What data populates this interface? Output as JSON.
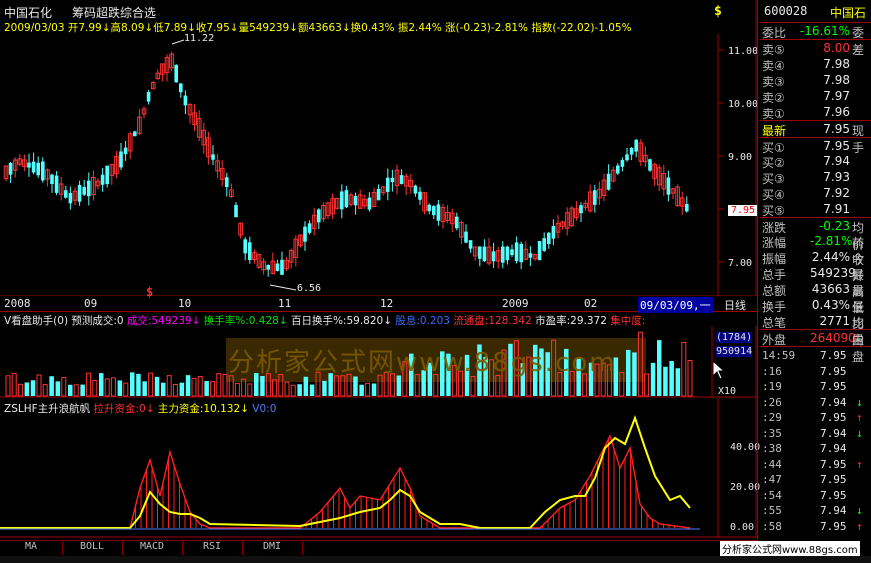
{
  "header": {
    "stock_name": "中国石化",
    "tab": "筹码超跌综合选",
    "badge": "$",
    "line": "2009/03/03 开7.99↓高8.09↓低7.89↓收7.95↓量549239↓额43663↓换0.43% 振2.44% 涨(-0.23)-2.81% 指数(-22.02)-1.05%"
  },
  "main": {
    "price_ticks": [
      "11.00",
      "10.00",
      "9.00",
      "8.00",
      "7.00"
    ],
    "high_label": "11.22",
    "low_label": "6.56",
    "current_price": "7.95",
    "dollar_marker": "$",
    "date_axis": [
      "2008",
      "09",
      "10",
      "11",
      "12",
      "2009",
      "02",
      "09/03/09,一"
    ],
    "date_axis_right": "日线"
  },
  "volume_panel": {
    "title": "V看盘助手(0) 预测成交:0",
    "fields": [
      {
        "text": "成交:549239↓",
        "color": "#ff00ff"
      },
      {
        "text": "换手率%:0.428↓",
        "color": "#00e000"
      },
      {
        "text": "百日换手%:59.820↓",
        "color": "#e8e8e8"
      },
      {
        "text": "股息:0.203",
        "color": "#3b6bff"
      },
      {
        "text": "流通盘:128.342",
        "color": "#ff3232"
      },
      {
        "text": "市盈率:29.372",
        "color": "#e8e8e8"
      },
      {
        "text": "集中度:",
        "color": "#ff3232"
      }
    ],
    "scale_top": "(1784)",
    "scale_value": "950914",
    "scale_unit": "X10",
    "watermark": "分析家公式网www.88gs.com"
  },
  "indicator_panel": {
    "title": "ZSLHF主升浪航帆",
    "fields": [
      {
        "text": "拉升资金:0↓",
        "color": "#ff3232"
      },
      {
        "text": "主力资金:10.132↓",
        "color": "#ffff00"
      },
      {
        "text": "V0:0",
        "color": "#4f7dff"
      }
    ],
    "ticks": [
      "40.00",
      "20.00",
      "0.00"
    ]
  },
  "tabs": [
    "MA",
    "BOLL",
    "MACD",
    "RSI",
    "DMI"
  ],
  "footer_watermark": "分析家公式网www.88gs.com",
  "sidebar": {
    "code": "600028",
    "name": "中国石",
    "weibi_label": "委比",
    "weibi_value": "-16.61%",
    "weibi_extra": "委差",
    "sell": [
      {
        "label": "卖⑤",
        "price": "8.00"
      },
      {
        "label": "卖④",
        "price": "7.98"
      },
      {
        "label": "卖③",
        "price": "7.98"
      },
      {
        "label": "卖②",
        "price": "7.97"
      },
      {
        "label": "卖①",
        "price": "7.96"
      }
    ],
    "latest": {
      "label": "最新",
      "price": "7.95",
      "extra": "现手"
    },
    "buy": [
      {
        "label": "买①",
        "price": "7.95"
      },
      {
        "label": "买②",
        "price": "7.94"
      },
      {
        "label": "买③",
        "price": "7.93"
      },
      {
        "label": "买④",
        "price": "7.92"
      },
      {
        "label": "买⑤",
        "price": "7.91"
      }
    ],
    "stats": [
      {
        "label": "涨跌",
        "value": "-0.23",
        "extra": "均价"
      },
      {
        "label": "涨幅",
        "value": "-2.81%",
        "extra": "前收"
      },
      {
        "label": "振幅",
        "value": "2.44%",
        "extra": "今开"
      },
      {
        "label": "总手",
        "value": "549239",
        "extra": "最高"
      },
      {
        "label": "总额",
        "value": "43663",
        "extra": "最低"
      },
      {
        "label": "换手",
        "value": "0.43%",
        "extra": "量比"
      },
      {
        "label": "总笔",
        "value": "2771",
        "extra": "均量"
      }
    ],
    "outer_label": "外盘",
    "outer_value": "264090",
    "inner_label": "内盘",
    "ticks": [
      {
        "time": "14:59",
        "price": "7.95",
        "dir": ""
      },
      {
        "time": ":16",
        "price": "7.95",
        "dir": ""
      },
      {
        "time": ":19",
        "price": "7.95",
        "dir": ""
      },
      {
        "time": ":26",
        "price": "7.94",
        "dir": "↓"
      },
      {
        "time": ":29",
        "price": "7.95",
        "dir": "↑"
      },
      {
        "time": ":35",
        "price": "7.94",
        "dir": "↓"
      },
      {
        "time": ":38",
        "price": "7.94",
        "dir": ""
      },
      {
        "time": ":44",
        "price": "7.95",
        "dir": "↑"
      },
      {
        "time": ":47",
        "price": "7.95",
        "dir": ""
      },
      {
        "time": ":54",
        "price": "7.95",
        "dir": ""
      },
      {
        "time": ":55",
        "price": "7.94",
        "dir": "↓"
      },
      {
        "time": ":58",
        "price": "7.95",
        "dir": "↑"
      }
    ]
  },
  "colors": {
    "up": "#ff3232",
    "down": "#54ffff",
    "axis": "#a00000",
    "yellow": "#ffff00"
  }
}
